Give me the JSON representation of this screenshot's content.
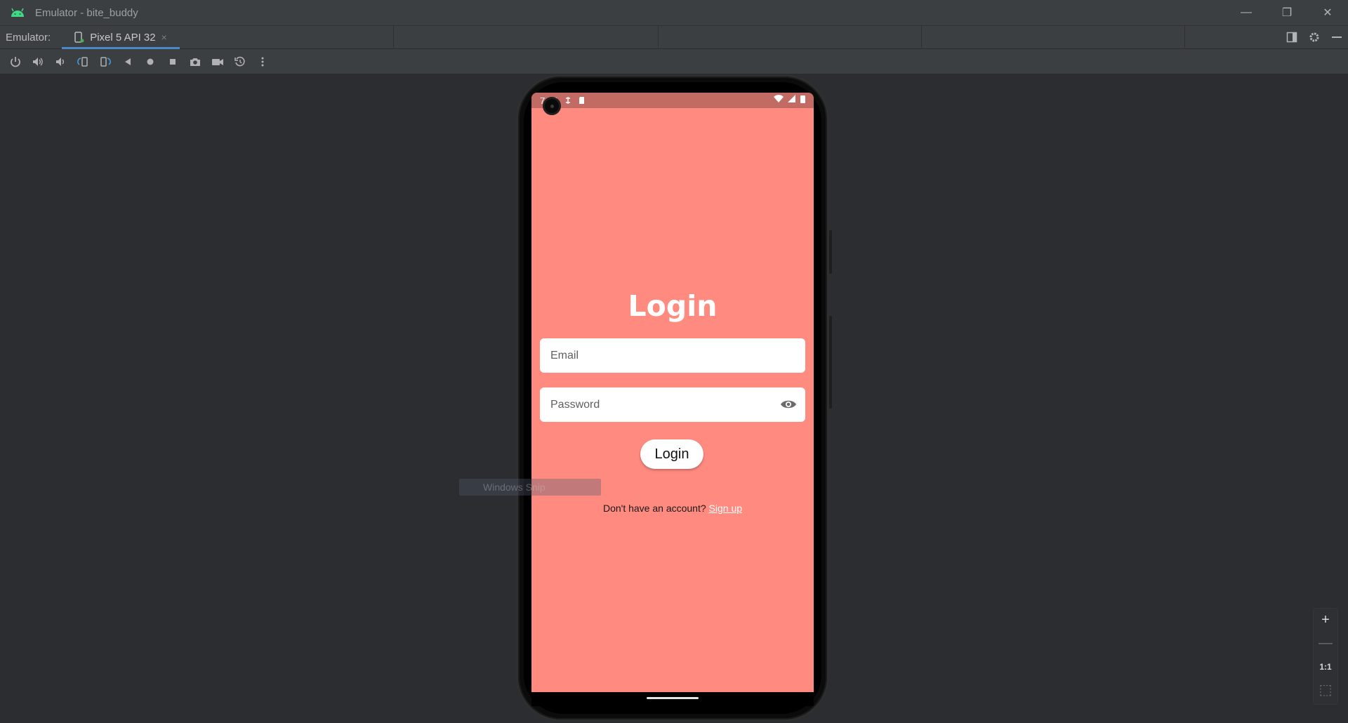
{
  "window": {
    "title": "Emulator - bite_buddy",
    "minimize": "—",
    "restore": "❐",
    "close": "✕"
  },
  "tabbar": {
    "label": "Emulator:",
    "tab_name": "Pixel 5 API 32",
    "tab_close": "×"
  },
  "toolbar": {
    "icons": [
      "power-icon",
      "volume-up-icon",
      "volume-down-icon",
      "rotate-left-icon",
      "rotate-right-icon",
      "back-icon",
      "home-icon",
      "overview-icon",
      "camera-icon",
      "video-icon",
      "snapshot-icon",
      "more-icon"
    ]
  },
  "status": {
    "time": "7:54"
  },
  "app": {
    "title": "Login",
    "email_placeholder": "Email",
    "password_placeholder": "Password",
    "login_button": "Login",
    "signup_prompt": "Don't have an account?",
    "signup_link": "Sign up",
    "background_color": "#ff8a80"
  },
  "ghost": {
    "text": "Windows Snip"
  },
  "zoom": {
    "plus": "+",
    "minus": "—",
    "one_to_one": "1:1",
    "fit": "⬚"
  }
}
